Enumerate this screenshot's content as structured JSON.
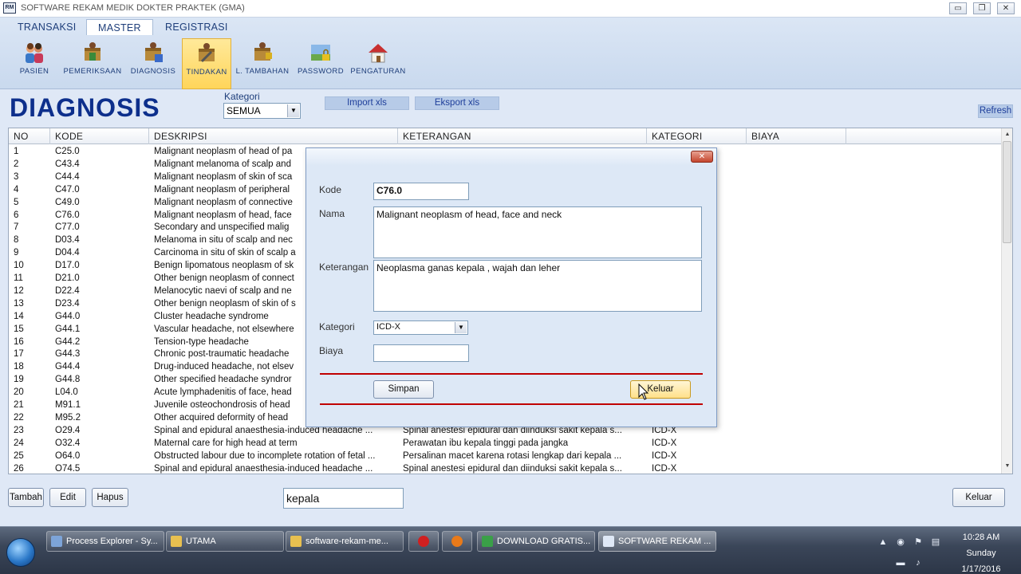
{
  "window": {
    "icon_text": "RM",
    "title": "SOFTWARE REKAM MEDIK DOKTER PRAKTEK (GMA)",
    "minimize": "▭",
    "restore": "❐",
    "close": "✕"
  },
  "ribbon": {
    "tabs": [
      {
        "label": "TRANSAKSI"
      },
      {
        "label": "MASTER"
      },
      {
        "label": "REGISTRASI"
      }
    ],
    "tools": [
      {
        "label": "PASIEN"
      },
      {
        "label": "PEMERIKSAAN"
      },
      {
        "label": "DIAGNOSIS"
      },
      {
        "label": "TINDAKAN"
      },
      {
        "label": "L. TAMBAHAN"
      },
      {
        "label": "PASSWORD"
      },
      {
        "label": "PENGATURAN"
      }
    ]
  },
  "header": {
    "title": "DIAGNOSIS",
    "kategori_label": "Kategori",
    "kategori_value": "SEMUA",
    "import_label": "Import xls",
    "export_label": "Eksport xls",
    "refresh_label": "Refresh"
  },
  "grid": {
    "columns": [
      "NO",
      "KODE",
      "DESKRIPSI",
      "KETERANGAN",
      "KATEGORI",
      "BIAYA"
    ],
    "rows": [
      {
        "no": "1",
        "kode": "C25.0",
        "deskripsi": "Malignant neoplasm of head of pa",
        "keterangan": "",
        "kategori": ""
      },
      {
        "no": "2",
        "kode": "C43.4",
        "deskripsi": "Malignant melanoma of scalp and",
        "keterangan": "",
        "kategori": ""
      },
      {
        "no": "3",
        "kode": "C44.4",
        "deskripsi": "Malignant neoplasm of skin of sca",
        "keterangan": "",
        "kategori": ""
      },
      {
        "no": "4",
        "kode": "C47.0",
        "deskripsi": "Malignant neoplasm of peripheral",
        "keterangan": "",
        "kategori": ""
      },
      {
        "no": "5",
        "kode": "C49.0",
        "deskripsi": "Malignant neoplasm of connective",
        "keterangan": "",
        "kategori": ""
      },
      {
        "no": "6",
        "kode": "C76.0",
        "deskripsi": "Malignant neoplasm of head, face",
        "keterangan": "",
        "kategori": ""
      },
      {
        "no": "7",
        "kode": "C77.0",
        "deskripsi": "Secondary and unspecified malig",
        "keterangan": "",
        "kategori": ""
      },
      {
        "no": "8",
        "kode": "D03.4",
        "deskripsi": "Melanoma in situ of scalp and nec",
        "keterangan": "",
        "kategori": ""
      },
      {
        "no": "9",
        "kode": "D04.4",
        "deskripsi": "Carcinoma in situ of skin of scalp a",
        "keterangan": "",
        "kategori": ""
      },
      {
        "no": "10",
        "kode": "D17.0",
        "deskripsi": "Benign lipomatous neoplasm of sk",
        "keterangan": "",
        "kategori": ""
      },
      {
        "no": "11",
        "kode": "D21.0",
        "deskripsi": "Other benign neoplasm of connect",
        "keterangan": "",
        "kategori": ""
      },
      {
        "no": "12",
        "kode": "D22.4",
        "deskripsi": "Melanocytic naevi of scalp and ne",
        "keterangan": "",
        "kategori": ""
      },
      {
        "no": "13",
        "kode": "D23.4",
        "deskripsi": "Other benign neoplasm of skin of s",
        "keterangan": "",
        "kategori": ""
      },
      {
        "no": "14",
        "kode": "G44.0",
        "deskripsi": "Cluster headache syndrome",
        "keterangan": "",
        "kategori": ""
      },
      {
        "no": "15",
        "kode": "G44.1",
        "deskripsi": "Vascular headache, not elsewhere",
        "keterangan": "",
        "kategori": ""
      },
      {
        "no": "16",
        "kode": "G44.2",
        "deskripsi": "Tension-type headache",
        "keterangan": "",
        "kategori": ""
      },
      {
        "no": "17",
        "kode": "G44.3",
        "deskripsi": "Chronic post-traumatic headache",
        "keterangan": "",
        "kategori": ""
      },
      {
        "no": "18",
        "kode": "G44.4",
        "deskripsi": "Drug-induced headache, not elsev",
        "keterangan": "",
        "kategori": ""
      },
      {
        "no": "19",
        "kode": "G44.8",
        "deskripsi": "Other specified headache syndror",
        "keterangan": "",
        "kategori": ""
      },
      {
        "no": "20",
        "kode": "L04.0",
        "deskripsi": "Acute lymphadenitis of face, head",
        "keterangan": "",
        "kategori": ""
      },
      {
        "no": "21",
        "kode": "M91.1",
        "deskripsi": "Juvenile osteochondrosis of head",
        "keterangan": "",
        "kategori": ""
      },
      {
        "no": "22",
        "kode": "M95.2",
        "deskripsi": "Other acquired deformity of head",
        "keterangan": "",
        "kategori": ""
      },
      {
        "no": "23",
        "kode": "O29.4",
        "deskripsi": "Spinal and epidural anaesthesia-induced headache ...",
        "keterangan": "Spinal anestesi epidural dan diinduksi sakit kepala s...",
        "kategori": "ICD-X"
      },
      {
        "no": "24",
        "kode": "O32.4",
        "deskripsi": "Maternal care for high head at term",
        "keterangan": "Perawatan ibu kepala tinggi pada jangka",
        "kategori": "ICD-X"
      },
      {
        "no": "25",
        "kode": "O64.0",
        "deskripsi": "Obstructed labour due to incomplete rotation of fetal ...",
        "keterangan": "Persalinan macet karena rotasi lengkap dari kepala ...",
        "kategori": "ICD-X"
      },
      {
        "no": "26",
        "kode": "O74.5",
        "deskripsi": "Spinal and epidural anaesthesia-induced headache ...",
        "keterangan": "Spinal anestesi epidural dan diinduksi sakit kepala s...",
        "kategori": "ICD-X"
      }
    ]
  },
  "bottom": {
    "tambah_label": "Tambah",
    "edit_label": "Edit",
    "hapus_label": "Hapus",
    "search_value": "kepala",
    "keluar_label": "Keluar"
  },
  "dialog": {
    "close": "✕",
    "kode_label": "Kode",
    "kode_value": "C76.0",
    "nama_label": "Nama",
    "nama_value": "Malignant neoplasm of head, face and neck",
    "keterangan_label": "Keterangan",
    "keterangan_value": "Neoplasma ganas kepala , wajah dan leher",
    "kategori_label": "Kategori",
    "kategori_value": "ICD-X",
    "biaya_label": "Biaya",
    "biaya_value": "",
    "simpan_label": "Simpan",
    "keluar_label": "Keluar"
  },
  "taskbar": {
    "tasks": [
      {
        "label": "Process Explorer - Sy...",
        "icon_color": "#7da4d8"
      },
      {
        "label": "UTAMA",
        "icon_color": "#e8c050"
      },
      {
        "label": "software-rekam-me...",
        "icon_color": "#e8c050"
      },
      {
        "label": "",
        "icon_color": "#d02020"
      },
      {
        "label": "",
        "icon_color": "#e87a1a"
      },
      {
        "label": "DOWNLOAD GRATIS...",
        "icon_color": "#3aa048"
      },
      {
        "label": "SOFTWARE REKAM ...",
        "icon_color": "#dfe8f6"
      }
    ],
    "clock_time": "10:28 AM",
    "clock_day": "Sunday",
    "clock_date": "1/17/2016"
  }
}
